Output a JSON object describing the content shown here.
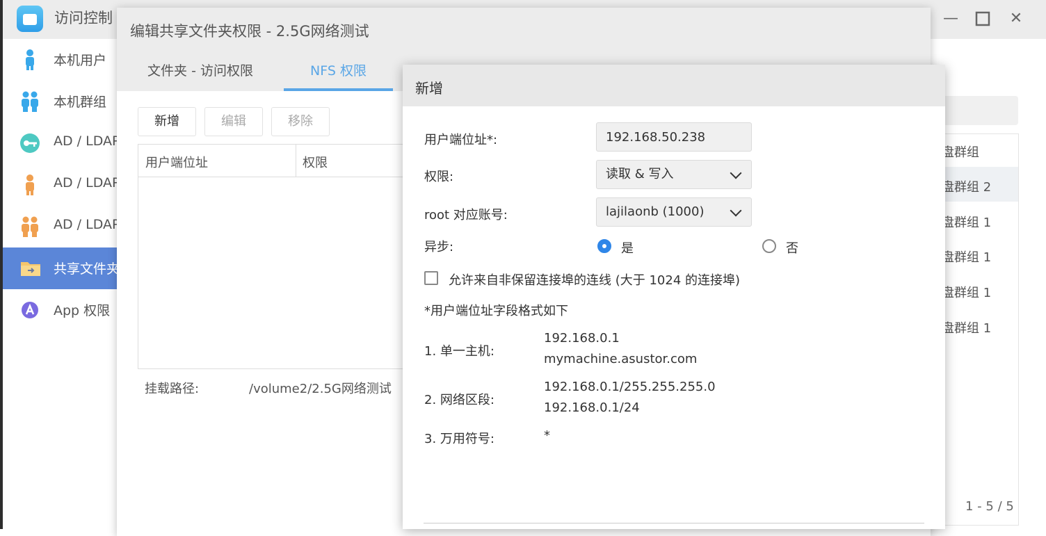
{
  "background_app": {
    "title": "访问控制",
    "window_controls": [
      "minimize-icon",
      "maximize-icon",
      "close-icon"
    ],
    "sidebar": [
      {
        "label": "本机用户",
        "icon": "user-icon"
      },
      {
        "label": "本机群组",
        "icon": "group-icon"
      },
      {
        "label": "AD / LDAP",
        "icon": "key-icon"
      },
      {
        "label": "AD / LDAP",
        "icon": "user-icon"
      },
      {
        "label": "AD / LDAP",
        "icon": "group-icon"
      },
      {
        "label": "共享文件夹",
        "icon": "shared-folder-icon",
        "active": true
      },
      {
        "label": "App 权限",
        "icon": "app-icon"
      }
    ],
    "right_table": {
      "header": "盘群组",
      "rows": [
        "盘群组 2",
        "盘群组 1",
        "盘群组 1",
        "盘群组 1",
        "盘群组 1"
      ],
      "pager": "1 - 5 / 5"
    }
  },
  "edit_dialog": {
    "title": "编辑共享文件夹权限 - 2.5G网络测试",
    "tabs": [
      "文件夹 - 访问权限",
      "NFS 权限"
    ],
    "active_tab": "NFS 权限",
    "toolbar": {
      "add": "新增",
      "edit": "编辑",
      "remove": "移除"
    },
    "table_headers": [
      "用户端位址",
      "权限"
    ],
    "mount_label": "挂载路径:",
    "mount_path": "/volume2/2.5G网络测试"
  },
  "add_dialog": {
    "title": "新增",
    "client_address_label": "用户端位址*:",
    "client_address_value": "192.168.50.238",
    "permission_label": "权限:",
    "permission_value": "读取 & 写入",
    "root_mapping_label": "root 对应账号:",
    "root_mapping_value": "lajilaonb (1000)",
    "async_label": "异步:",
    "async_options": [
      {
        "label": "是",
        "selected": true
      },
      {
        "label": "否",
        "selected": false
      }
    ],
    "allow_nonreserved_label": "允许来自非保留连接埠的连线 (大于 1024 的连接埠)",
    "allow_nonreserved_checked": false,
    "format_title": "*用户端位址字段格式如下",
    "examples": [
      {
        "label": "1. 单一主机:",
        "values": [
          "192.168.0.1",
          "mymachine.asustor.com"
        ]
      },
      {
        "label": "2. 网络区段:",
        "values": [
          "192.168.0.1/255.255.255.0",
          "192.168.0.1/24"
        ]
      },
      {
        "label": "3. 万用符号:",
        "values": [
          "*"
        ]
      }
    ]
  },
  "colors": {
    "accent": "#5aa6e6",
    "sidebar_active": "#5b86d8",
    "radio_on": "#2f86e8"
  }
}
